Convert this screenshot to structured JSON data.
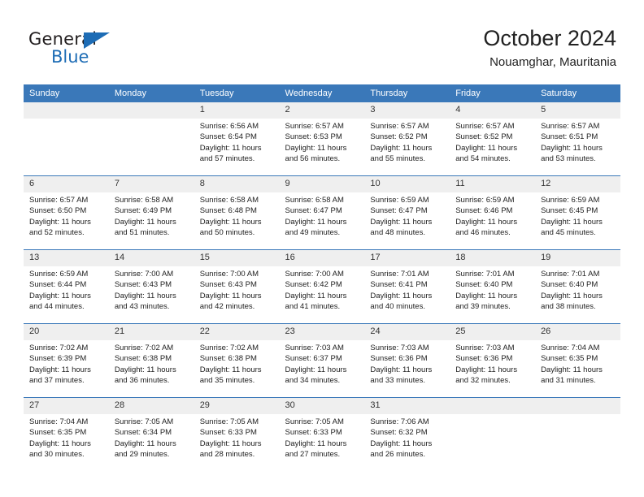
{
  "logo": {
    "word1": "General",
    "word2": "Blue",
    "triangle_color": "#1d6cb5"
  },
  "header": {
    "title": "October 2024",
    "subtitle": "Nouamghar, Mauritania"
  },
  "theme": {
    "header_blue": "#3a78b9",
    "daynum_band": "#efefef",
    "text": "#222222"
  },
  "weekday_headers": [
    "Sunday",
    "Monday",
    "Tuesday",
    "Wednesday",
    "Thursday",
    "Friday",
    "Saturday"
  ],
  "weeks": [
    [
      {
        "day": "",
        "sunrise": "",
        "sunset": "",
        "daylight1": "",
        "daylight2": ""
      },
      {
        "day": "",
        "sunrise": "",
        "sunset": "",
        "daylight1": "",
        "daylight2": ""
      },
      {
        "day": "1",
        "sunrise": "Sunrise: 6:56 AM",
        "sunset": "Sunset: 6:54 PM",
        "daylight1": "Daylight: 11 hours",
        "daylight2": "and 57 minutes."
      },
      {
        "day": "2",
        "sunrise": "Sunrise: 6:57 AM",
        "sunset": "Sunset: 6:53 PM",
        "daylight1": "Daylight: 11 hours",
        "daylight2": "and 56 minutes."
      },
      {
        "day": "3",
        "sunrise": "Sunrise: 6:57 AM",
        "sunset": "Sunset: 6:52 PM",
        "daylight1": "Daylight: 11 hours",
        "daylight2": "and 55 minutes."
      },
      {
        "day": "4",
        "sunrise": "Sunrise: 6:57 AM",
        "sunset": "Sunset: 6:52 PM",
        "daylight1": "Daylight: 11 hours",
        "daylight2": "and 54 minutes."
      },
      {
        "day": "5",
        "sunrise": "Sunrise: 6:57 AM",
        "sunset": "Sunset: 6:51 PM",
        "daylight1": "Daylight: 11 hours",
        "daylight2": "and 53 minutes."
      }
    ],
    [
      {
        "day": "6",
        "sunrise": "Sunrise: 6:57 AM",
        "sunset": "Sunset: 6:50 PM",
        "daylight1": "Daylight: 11 hours",
        "daylight2": "and 52 minutes."
      },
      {
        "day": "7",
        "sunrise": "Sunrise: 6:58 AM",
        "sunset": "Sunset: 6:49 PM",
        "daylight1": "Daylight: 11 hours",
        "daylight2": "and 51 minutes."
      },
      {
        "day": "8",
        "sunrise": "Sunrise: 6:58 AM",
        "sunset": "Sunset: 6:48 PM",
        "daylight1": "Daylight: 11 hours",
        "daylight2": "and 50 minutes."
      },
      {
        "day": "9",
        "sunrise": "Sunrise: 6:58 AM",
        "sunset": "Sunset: 6:47 PM",
        "daylight1": "Daylight: 11 hours",
        "daylight2": "and 49 minutes."
      },
      {
        "day": "10",
        "sunrise": "Sunrise: 6:59 AM",
        "sunset": "Sunset: 6:47 PM",
        "daylight1": "Daylight: 11 hours",
        "daylight2": "and 48 minutes."
      },
      {
        "day": "11",
        "sunrise": "Sunrise: 6:59 AM",
        "sunset": "Sunset: 6:46 PM",
        "daylight1": "Daylight: 11 hours",
        "daylight2": "and 46 minutes."
      },
      {
        "day": "12",
        "sunrise": "Sunrise: 6:59 AM",
        "sunset": "Sunset: 6:45 PM",
        "daylight1": "Daylight: 11 hours",
        "daylight2": "and 45 minutes."
      }
    ],
    [
      {
        "day": "13",
        "sunrise": "Sunrise: 6:59 AM",
        "sunset": "Sunset: 6:44 PM",
        "daylight1": "Daylight: 11 hours",
        "daylight2": "and 44 minutes."
      },
      {
        "day": "14",
        "sunrise": "Sunrise: 7:00 AM",
        "sunset": "Sunset: 6:43 PM",
        "daylight1": "Daylight: 11 hours",
        "daylight2": "and 43 minutes."
      },
      {
        "day": "15",
        "sunrise": "Sunrise: 7:00 AM",
        "sunset": "Sunset: 6:43 PM",
        "daylight1": "Daylight: 11 hours",
        "daylight2": "and 42 minutes."
      },
      {
        "day": "16",
        "sunrise": "Sunrise: 7:00 AM",
        "sunset": "Sunset: 6:42 PM",
        "daylight1": "Daylight: 11 hours",
        "daylight2": "and 41 minutes."
      },
      {
        "day": "17",
        "sunrise": "Sunrise: 7:01 AM",
        "sunset": "Sunset: 6:41 PM",
        "daylight1": "Daylight: 11 hours",
        "daylight2": "and 40 minutes."
      },
      {
        "day": "18",
        "sunrise": "Sunrise: 7:01 AM",
        "sunset": "Sunset: 6:40 PM",
        "daylight1": "Daylight: 11 hours",
        "daylight2": "and 39 minutes."
      },
      {
        "day": "19",
        "sunrise": "Sunrise: 7:01 AM",
        "sunset": "Sunset: 6:40 PM",
        "daylight1": "Daylight: 11 hours",
        "daylight2": "and 38 minutes."
      }
    ],
    [
      {
        "day": "20",
        "sunrise": "Sunrise: 7:02 AM",
        "sunset": "Sunset: 6:39 PM",
        "daylight1": "Daylight: 11 hours",
        "daylight2": "and 37 minutes."
      },
      {
        "day": "21",
        "sunrise": "Sunrise: 7:02 AM",
        "sunset": "Sunset: 6:38 PM",
        "daylight1": "Daylight: 11 hours",
        "daylight2": "and 36 minutes."
      },
      {
        "day": "22",
        "sunrise": "Sunrise: 7:02 AM",
        "sunset": "Sunset: 6:38 PM",
        "daylight1": "Daylight: 11 hours",
        "daylight2": "and 35 minutes."
      },
      {
        "day": "23",
        "sunrise": "Sunrise: 7:03 AM",
        "sunset": "Sunset: 6:37 PM",
        "daylight1": "Daylight: 11 hours",
        "daylight2": "and 34 minutes."
      },
      {
        "day": "24",
        "sunrise": "Sunrise: 7:03 AM",
        "sunset": "Sunset: 6:36 PM",
        "daylight1": "Daylight: 11 hours",
        "daylight2": "and 33 minutes."
      },
      {
        "day": "25",
        "sunrise": "Sunrise: 7:03 AM",
        "sunset": "Sunset: 6:36 PM",
        "daylight1": "Daylight: 11 hours",
        "daylight2": "and 32 minutes."
      },
      {
        "day": "26",
        "sunrise": "Sunrise: 7:04 AM",
        "sunset": "Sunset: 6:35 PM",
        "daylight1": "Daylight: 11 hours",
        "daylight2": "and 31 minutes."
      }
    ],
    [
      {
        "day": "27",
        "sunrise": "Sunrise: 7:04 AM",
        "sunset": "Sunset: 6:35 PM",
        "daylight1": "Daylight: 11 hours",
        "daylight2": "and 30 minutes."
      },
      {
        "day": "28",
        "sunrise": "Sunrise: 7:05 AM",
        "sunset": "Sunset: 6:34 PM",
        "daylight1": "Daylight: 11 hours",
        "daylight2": "and 29 minutes."
      },
      {
        "day": "29",
        "sunrise": "Sunrise: 7:05 AM",
        "sunset": "Sunset: 6:33 PM",
        "daylight1": "Daylight: 11 hours",
        "daylight2": "and 28 minutes."
      },
      {
        "day": "30",
        "sunrise": "Sunrise: 7:05 AM",
        "sunset": "Sunset: 6:33 PM",
        "daylight1": "Daylight: 11 hours",
        "daylight2": "and 27 minutes."
      },
      {
        "day": "31",
        "sunrise": "Sunrise: 7:06 AM",
        "sunset": "Sunset: 6:32 PM",
        "daylight1": "Daylight: 11 hours",
        "daylight2": "and 26 minutes."
      },
      {
        "day": "",
        "sunrise": "",
        "sunset": "",
        "daylight1": "",
        "daylight2": ""
      },
      {
        "day": "",
        "sunrise": "",
        "sunset": "",
        "daylight1": "",
        "daylight2": ""
      }
    ]
  ]
}
